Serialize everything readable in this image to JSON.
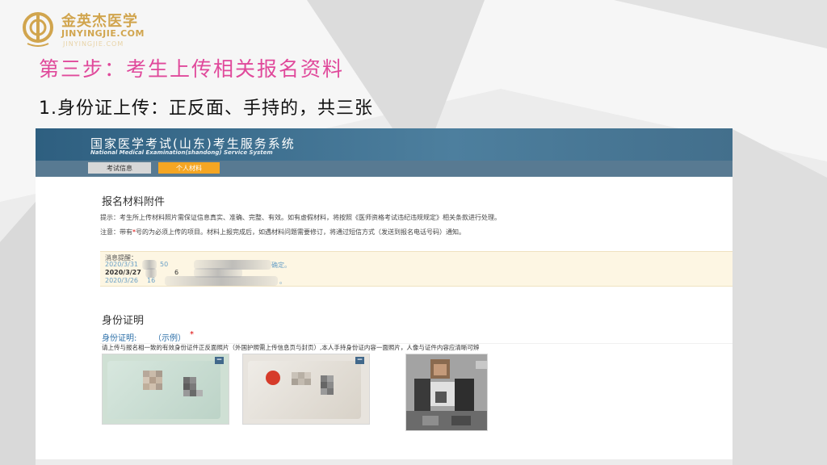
{
  "brand": {
    "name": "金英杰医学",
    "domain": "JINYINGJIE.COM",
    "domain_small": "JINYINGJIE.COM",
    "color": "#d1a54e"
  },
  "slide": {
    "step_title": "第三步：考生上传相关报名资料",
    "sub_title": "1.身份证上传：正反面、手持的，共三张",
    "step_color": "#e0499b"
  },
  "system": {
    "title": "国家医学考试(山东)考生服务系统",
    "subtitle": "National Medical Examination(shandong) Service System",
    "tabs": [
      {
        "label": "考试信息",
        "active": false
      },
      {
        "label": "个人材料",
        "active": true
      }
    ],
    "header_color": "#3f6f8f",
    "active_tab_color": "#f5a623"
  },
  "attachments": {
    "title": "报名材料附件",
    "tip": "提示：考生所上传材料照片需保证信息真实、准确、完整、有效。如有虚假材料，将按照《医师资格考试违纪违规规定》相关条款进行处理。",
    "note_prefix": "注意：带有",
    "note_star": "*",
    "note_suffix": "号的为必须上传的项目。材料上报完成后，如遇材料问题需要修订，将通过短信方式（发送到报名电话号码）通知。",
    "messages_title": "消息提醒：",
    "messages": [
      {
        "date": "2020/3/31",
        "time": "50",
        "tail": "确定。",
        "color": "#6aa0c6"
      },
      {
        "date": "2020/3/27",
        "time": "6",
        "tail": "",
        "color": "#333333"
      },
      {
        "date": "2020/3/26",
        "time": "16",
        "tail": "。",
        "color": "#6aa0c6"
      }
    ]
  },
  "identity": {
    "title": "身份证明",
    "label": "身份证明:",
    "example": "（示例）",
    "required": "*",
    "description": "请上传与报名相一致的有效身份证件正反面照片（外国护照需上传信息页与封页）,本人手持身份证内容一面照片，人像与证件内容应清晰可辨",
    "remove_symbol": "−"
  }
}
